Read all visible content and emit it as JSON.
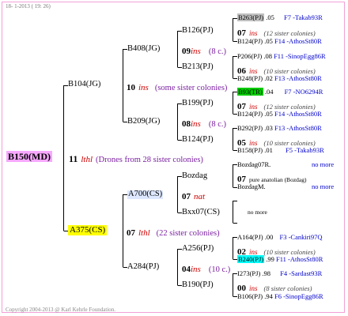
{
  "header": {
    "date": "18- 1-2013 ( 19: 26)"
  },
  "footer": {
    "copyright": "Copyright 2004-2013 @ Karl Kehrle Foundation."
  },
  "root": {
    "name": "B150(MD)",
    "mid_number": "11",
    "mid_ins": "lthl",
    "note": "(Drones from 28 sister colonies)"
  },
  "father_line": {
    "name": "B104(JG)",
    "number": "10",
    "ins": "ins",
    "note": "(some sister colonies)",
    "b408": {
      "name": "B408(JG)",
      "number": "09",
      "ins": "ins",
      "note": "(8 c.)",
      "b126": {
        "name": "B126(PJ)",
        "top": {
          "name": "B263(PJ)",
          "val": ".05",
          "link": "F7 -Takab93R"
        },
        "mid_num": "07",
        "mid_ins": "ins",
        "mid_note": "(12 sister colonies)",
        "bot": {
          "name": "B124(PJ)",
          "val": ".05",
          "link": "F14 -AthosSt80R"
        }
      },
      "b213": {
        "name": "B213(PJ)",
        "top": {
          "name": "P206(PJ)",
          "val": ".08",
          "link": "F11 -SinopEgg86R"
        },
        "mid_num": "06",
        "mid_ins": "ins",
        "mid_note": "(10 sister colonies)",
        "bot": {
          "name": "B248(PJ)",
          "val": ".02",
          "link": "F13 -AthosSt80R"
        }
      }
    },
    "b209": {
      "name": "B209(JG)",
      "number": "08",
      "ins": "ins",
      "note": "(8 c.)",
      "b199": {
        "name": "B199(PJ)",
        "top": {
          "name": "B93(TR)",
          "val": ".04",
          "link": "F7 -NO6294R"
        },
        "mid_num": "07",
        "mid_ins": "ins",
        "mid_note": "(12 sister colonies)",
        "bot": {
          "name": "B124(PJ)",
          "val": ".05",
          "link": "F14 -AthosSt80R"
        }
      },
      "b124": {
        "name": "B124(PJ)",
        "top": {
          "name": "B292(PJ)",
          "val": ".03",
          "link": "F13 -AthosSt80R"
        },
        "mid_num": "05",
        "mid_ins": "ins",
        "mid_note": "(10 sister colonies)",
        "bot": {
          "name": "B158(PJ)",
          "val": ".01",
          "link": "F5 -Takab93R"
        }
      }
    }
  },
  "mother_line": {
    "name": "A375(CS)",
    "number": "07",
    "ins": "lthl",
    "note": "(22 sister colonies)",
    "a700": {
      "name": "A700(CS)",
      "number": "07",
      "ins": "nat",
      "bozdag": {
        "name": "Bozdag",
        "top": {
          "name": "Bozdag07R",
          "val": ".",
          "link": "no more"
        },
        "mid_num": "07",
        "mid_note": "pure anatolian (Bozdag)",
        "bot": {
          "name": "BozdagM",
          "val": ".",
          "link": "no more"
        }
      },
      "bxx07": {
        "name": "Bxx07(CS)",
        "note": "no more"
      }
    },
    "a284": {
      "name": "A284(PJ)",
      "number": "04",
      "ins": "ins",
      "note": "(10 c.)",
      "a256": {
        "name": "A256(PJ)",
        "top": {
          "name": "A164(PJ)",
          "val": ".00",
          "link": "F3 -Cankiri97Q"
        },
        "mid_num": "02",
        "mid_ins": "ins",
        "mid_note": "(10 sister colonies)",
        "bot": {
          "name": "B240(PJ)",
          "val": ".99",
          "link": "F11 -AthosSt80R"
        }
      },
      "b190": {
        "name": "B190(PJ)",
        "top": {
          "name": "I273(PJ)",
          "val": ".98",
          "link": "F4 -Sardast93R"
        },
        "mid_num": "00",
        "mid_ins": "ins",
        "mid_note": "(8 sister colonies)",
        "bot": {
          "name": "B106(PJ)",
          "val": ".94",
          "link": "F6 -SinopEgg86R"
        }
      }
    }
  },
  "colors": {
    "root_bg": "#f7a8ff",
    "mother_bg": "#ffff00",
    "line": "#000000",
    "ins": "#d00000",
    "note": "#7a1fa0",
    "link": "#0000cc",
    "highlight_grey": "#c0c0c0",
    "highlight_green": "#00cc00",
    "highlight_cyan": "#00ffff"
  }
}
